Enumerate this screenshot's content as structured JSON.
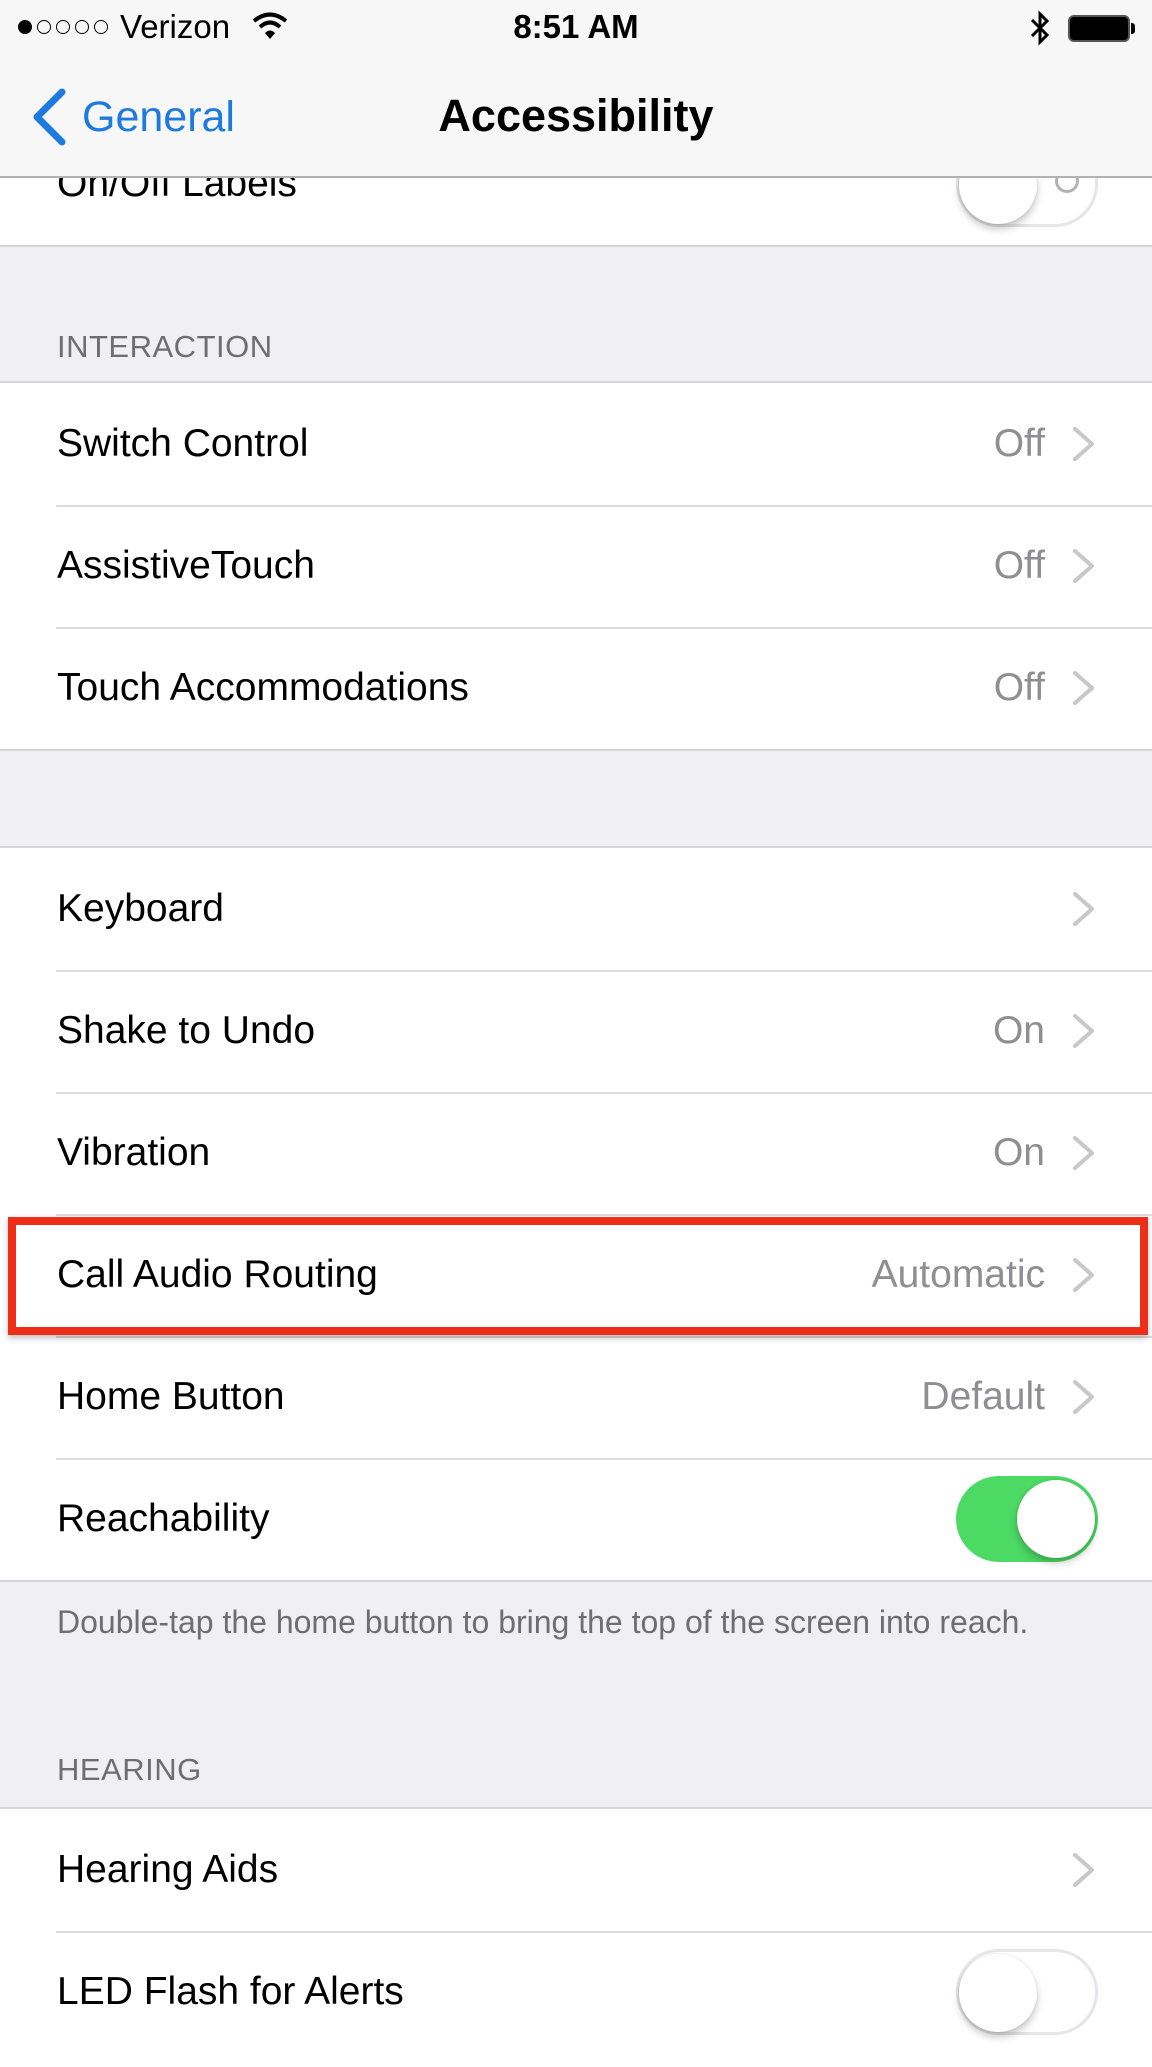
{
  "status_bar": {
    "signal_filled": 1,
    "signal_total": 5,
    "carrier": "Verizon",
    "time": "8:51 AM",
    "wifi_icon": "wifi-icon",
    "bluetooth_icon": "bluetooth-icon",
    "battery_icon": "battery-icon"
  },
  "nav": {
    "back_label": "General",
    "title": "Accessibility"
  },
  "top_partial_row": {
    "label": "On/Off Labels",
    "toggle_on": false
  },
  "sections": {
    "interaction": {
      "header": "INTERACTION",
      "rows": [
        {
          "label": "Switch Control",
          "value": "Off"
        },
        {
          "label": "AssistiveTouch",
          "value": "Off"
        },
        {
          "label": "Touch Accommodations",
          "value": "Off"
        }
      ]
    },
    "misc": {
      "rows": [
        {
          "label": "Keyboard",
          "value": ""
        },
        {
          "label": "Shake to Undo",
          "value": "On"
        },
        {
          "label": "Vibration",
          "value": "On"
        },
        {
          "label": "Call Audio Routing",
          "value": "Automatic",
          "highlighted": true
        },
        {
          "label": "Home Button",
          "value": "Default"
        },
        {
          "label": "Reachability",
          "toggle_on": true
        }
      ],
      "footer": "Double-tap the home button to bring the top of the screen into reach."
    },
    "hearing": {
      "header": "HEARING",
      "rows": [
        {
          "label": "Hearing Aids",
          "value": ""
        },
        {
          "label": "LED Flash for Alerts",
          "toggle_on": false
        }
      ]
    }
  },
  "colors": {
    "accent": "#1f7ae0",
    "toggle_on": "#4cd964",
    "highlight": "#ee2e17",
    "secondary_text": "#8e8e93",
    "group_background": "#efeff4"
  }
}
